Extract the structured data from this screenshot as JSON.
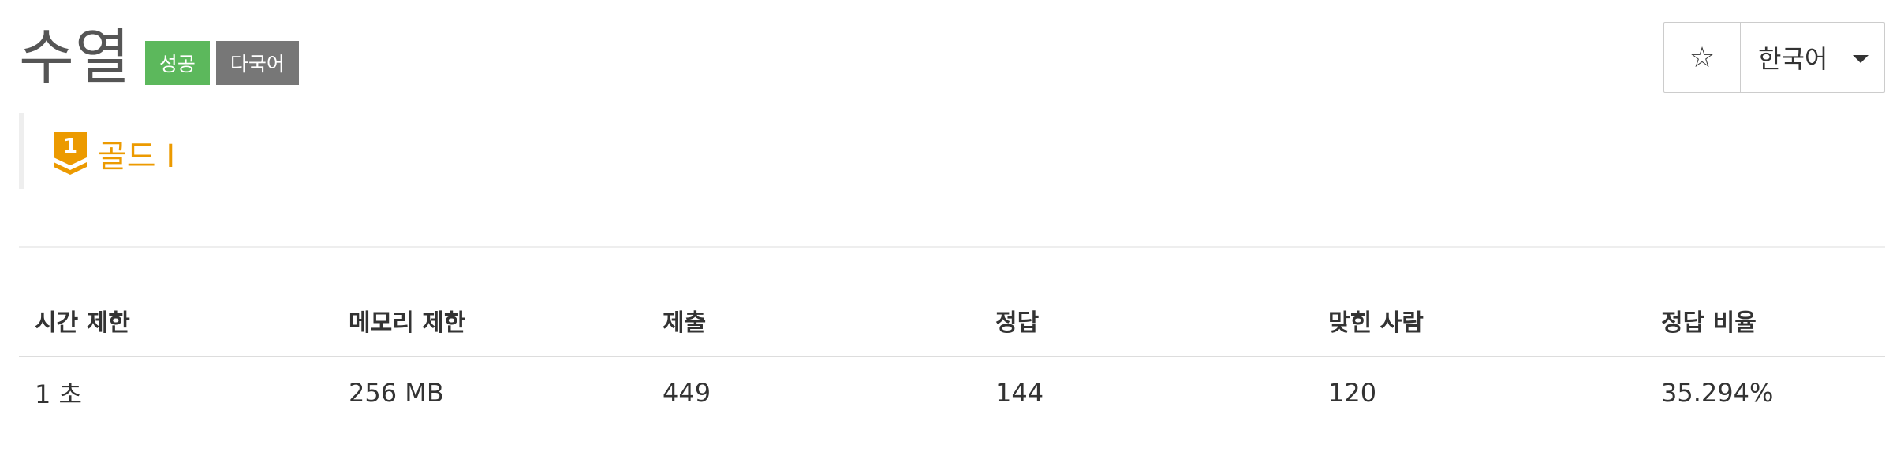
{
  "problem": {
    "title": "수열",
    "labels": [
      "성공",
      "다국어"
    ],
    "tier": {
      "name": "골드 I",
      "level": "1"
    }
  },
  "actions": {
    "star_symbol": "☆",
    "language": "한국어"
  },
  "info_table": {
    "headers": [
      "시간 제한",
      "메모리 제한",
      "제출",
      "정답",
      "맞힌 사람",
      "정답 비율"
    ],
    "values": [
      "1 초",
      "256 MB",
      "449",
      "144",
      "120",
      "35.294%"
    ]
  },
  "colors": {
    "success": "#5cb85c",
    "multilang": "#777777",
    "gold": "#ec9a00"
  }
}
